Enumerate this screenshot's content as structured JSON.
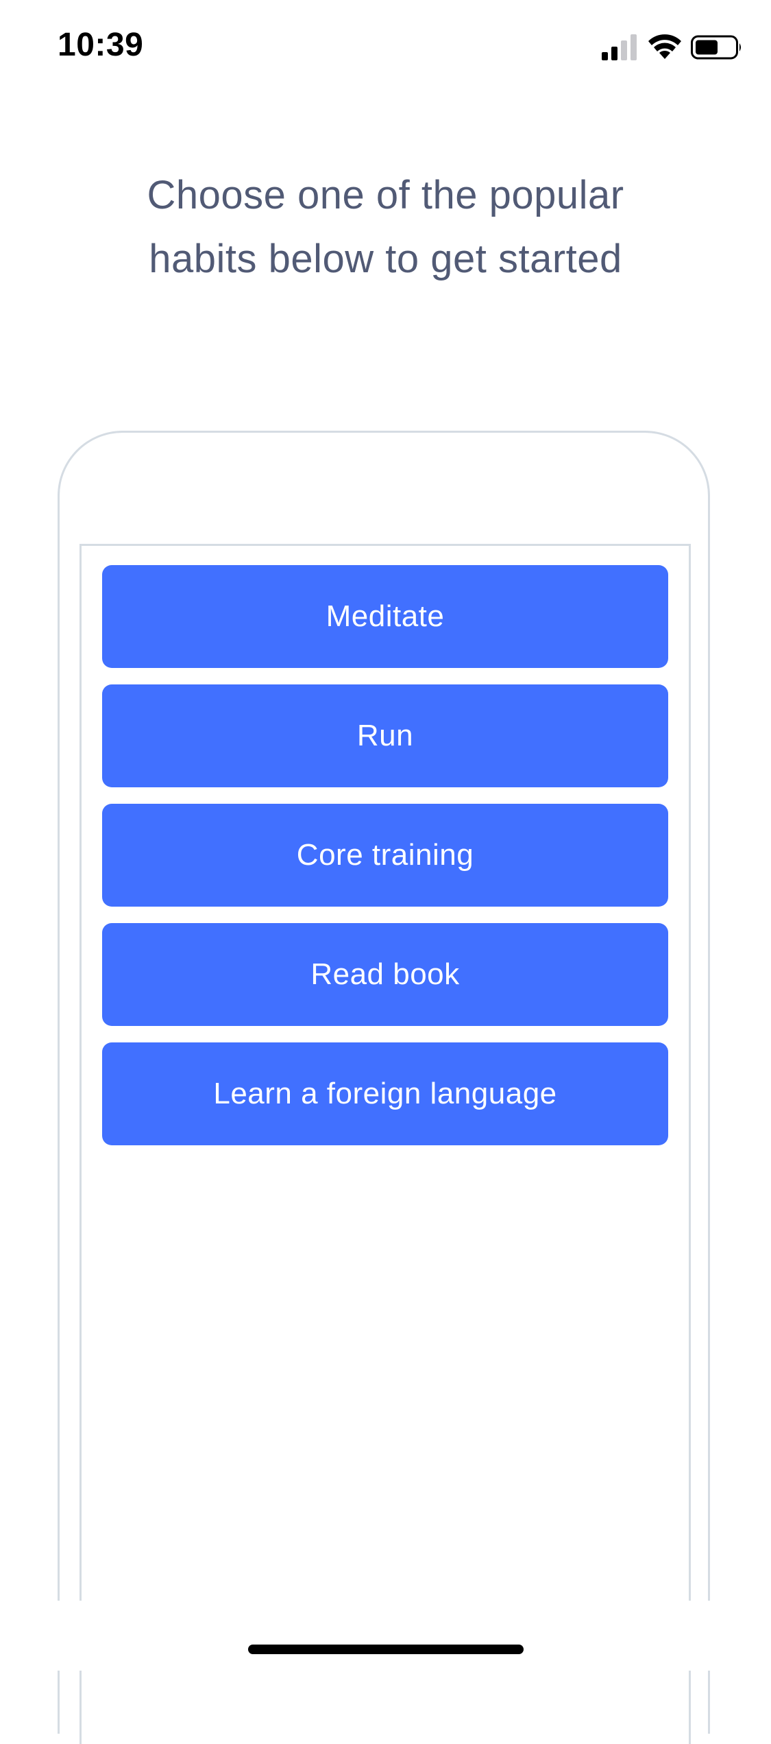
{
  "status_bar": {
    "time": "10:39",
    "icons": [
      "signal-icon",
      "wifi-icon",
      "battery-icon"
    ]
  },
  "heading": "Choose one of the popular habits below to get started",
  "habits": [
    {
      "label": "Meditate"
    },
    {
      "label": "Run"
    },
    {
      "label": "Core training"
    },
    {
      "label": "Read book"
    },
    {
      "label": "Learn a foreign language"
    }
  ],
  "colors": {
    "accent": "#4170ff",
    "heading_text": "#515a75",
    "frame_border": "#d5dce3",
    "button_text": "#ffffff"
  }
}
